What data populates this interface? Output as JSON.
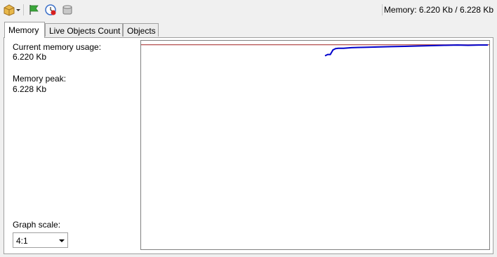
{
  "toolbar": {
    "buttons": [
      {
        "name": "package-dropdown-icon"
      },
      {
        "name": "flag-run-icon"
      },
      {
        "name": "timer-clock-icon"
      },
      {
        "name": "gc-disk-icon"
      }
    ]
  },
  "status": {
    "memory": "Memory: 6.220 Kb / 6.228 Kb"
  },
  "tabs": [
    {
      "label": "Memory"
    },
    {
      "label": "Live Objects Count"
    },
    {
      "label": "Objects"
    }
  ],
  "memory_panel": {
    "current_label": "Current memory usage:",
    "current_value": "6.220 Kb",
    "peak_label": "Memory peak:",
    "peak_value": "6.228 Kb",
    "scale_label": "Graph scale:",
    "scale_value": "4:1"
  },
  "chart_data": {
    "type": "line",
    "peak_line_color": "#a02020",
    "series_color": "#0000cc",
    "peak_value_kb": 6.228,
    "points": [
      [
        0,
        5.89
      ],
      [
        2,
        5.93
      ],
      [
        4,
        5.93
      ],
      [
        6,
        6.07
      ],
      [
        8,
        6.11
      ],
      [
        10,
        6.12
      ],
      [
        14,
        6.12
      ],
      [
        20,
        6.14
      ],
      [
        30,
        6.15
      ],
      [
        40,
        6.16
      ],
      [
        50,
        6.17
      ],
      [
        60,
        6.18
      ],
      [
        70,
        6.19
      ],
      [
        80,
        6.2
      ],
      [
        90,
        6.21
      ],
      [
        100,
        6.22
      ],
      [
        108,
        6.21
      ],
      [
        116,
        6.22
      ],
      [
        123,
        6.22
      ]
    ]
  },
  "colors": {
    "accent_blue": "#0000cc",
    "peak_red": "#a02020"
  }
}
